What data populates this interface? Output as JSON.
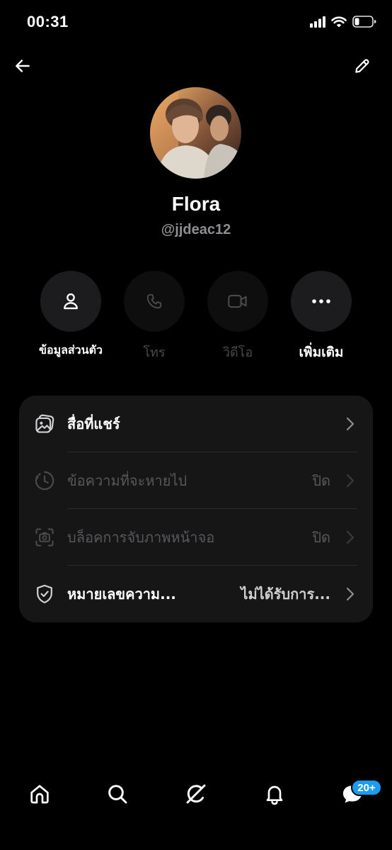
{
  "status_bar": {
    "time": "00:31",
    "icons": [
      "cellular-signal-icon",
      "wifi-icon",
      "battery-icon"
    ]
  },
  "header": {
    "back_icon": "arrow-left-icon",
    "edit_icon": "pencil-icon"
  },
  "profile": {
    "name": "Flora",
    "handle": "@jjdeac12"
  },
  "actions": [
    {
      "label": "ข้อมูลส่วนตัว",
      "icon": "person-icon",
      "enabled": true
    },
    {
      "label": "โทร",
      "icon": "phone-icon",
      "enabled": false
    },
    {
      "label": "วิดีโอ",
      "icon": "video-camera-icon",
      "enabled": false
    },
    {
      "label": "เพิ่มเติม",
      "icon": "more-dots-icon",
      "enabled": true
    }
  ],
  "settings": [
    {
      "label": "สื่อที่แชร์",
      "value": "",
      "icon": "shared-media-icon",
      "enabled": true
    },
    {
      "label": "ข้อความที่จะหายไป",
      "value": "ปิด",
      "icon": "timer-icon",
      "enabled": false
    },
    {
      "label": "บล็อคการจับภาพหน้าจอ",
      "value": "ปิด",
      "icon": "screenshot-icon",
      "enabled": false
    },
    {
      "label": "หมายเลขความ...",
      "value": "ไม่ได้รับการ...",
      "icon": "shield-check-icon",
      "enabled": true
    }
  ],
  "tab_bar": {
    "tabs": [
      "home-icon",
      "search-icon",
      "grok-icon",
      "notifications-icon",
      "messages-icon"
    ],
    "messages_badge": "20+"
  },
  "colors": {
    "background": "#000000",
    "card": "#161617",
    "accent": "#1d9bf0",
    "muted_text": "#8e8e93",
    "disabled_text": "#58585c"
  }
}
